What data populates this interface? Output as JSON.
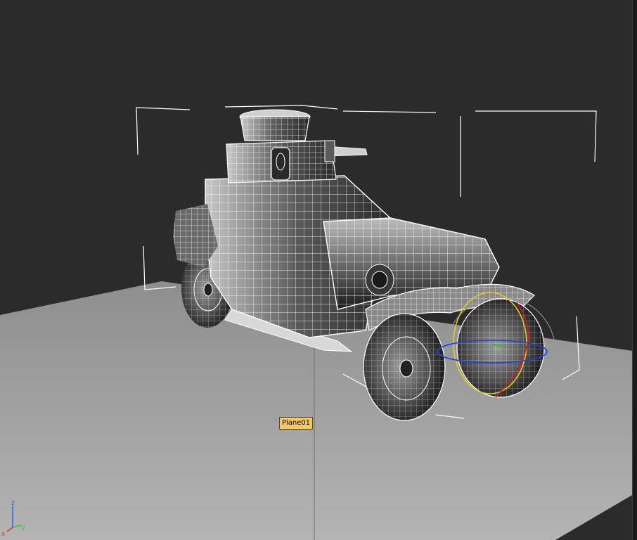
{
  "viewport": {
    "background_color": "#2b2b2b",
    "ground_color": "#a8a8a8",
    "wire_color": "#ffffff",
    "selection_bracket_color": "#ffffff"
  },
  "tooltip": {
    "label": "Plane01"
  },
  "axis_tripod": {
    "x_label": "x",
    "y_label": "y",
    "z_label": "z",
    "x_color": "#e03030",
    "y_color": "#30c030",
    "z_color": "#3060ff"
  },
  "rotate_gizmo": {
    "x_ring_color": "#d02020",
    "y_ring_color": "#20a020",
    "z_ring_color": "#2040e0",
    "screen_ring_color": "#e0d020"
  },
  "icons": [
    "axis-tripod-icon",
    "rotate-gizmo-icon"
  ]
}
